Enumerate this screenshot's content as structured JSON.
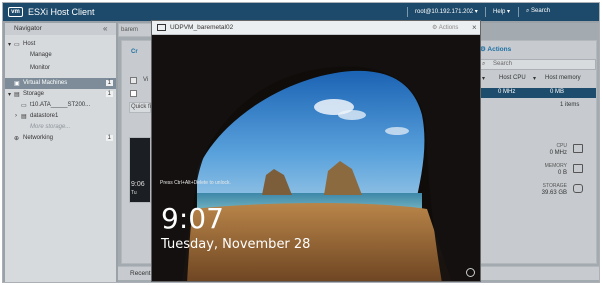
{
  "app": {
    "logo": "vm",
    "title": "ESXi Host Client",
    "user": "root@10.192.171.202",
    "help_label": "Help",
    "search_label": "Search"
  },
  "navigator": {
    "title": "Navigator",
    "items": [
      {
        "label": "Host",
        "badge": ""
      },
      {
        "label": "Manage",
        "badge": ""
      },
      {
        "label": "Monitor",
        "badge": ""
      },
      {
        "label": "Virtual Machines",
        "badge": "1"
      },
      {
        "label": "Storage",
        "badge": "1"
      },
      {
        "label": "t10.ATA_____ST200...",
        "badge": ""
      },
      {
        "label": "datastore1",
        "badge": ""
      },
      {
        "label": "More storage...",
        "badge": ""
      },
      {
        "label": "Networking",
        "badge": "1"
      }
    ]
  },
  "main": {
    "tab_fragment": "barem",
    "create_fragment": "Cr",
    "row_fragment": "Vi",
    "quick_fragment": "Quick fi",
    "thumb_time": "9:06",
    "thumb_day": "Tu",
    "actions_label": "Actions",
    "search_placeholder": "Search",
    "columns": [
      "Host CPU",
      "Host memory"
    ],
    "row_values": [
      "0 MHz",
      "0 MB"
    ],
    "items_count": "1 items",
    "resources": [
      {
        "label": "CPU",
        "value": "0 MHz"
      },
      {
        "label": "MEMORY",
        "value": "0 B"
      },
      {
        "label": "STORAGE",
        "value": "39.63 GB"
      }
    ],
    "recent_label": "Recent"
  },
  "console": {
    "title": "UDPVM_baremetal02",
    "actions_label": "Actions",
    "close_glyph": "×",
    "ctrl_alt_del": "Press Ctrl+Alt+Delete to unlock.",
    "time": "9:07",
    "date": "Tuesday, November 28"
  },
  "colors": {
    "topbar": "#1d4a6b",
    "accent": "#1d6fa5",
    "nav_active": "#7d8c98"
  }
}
